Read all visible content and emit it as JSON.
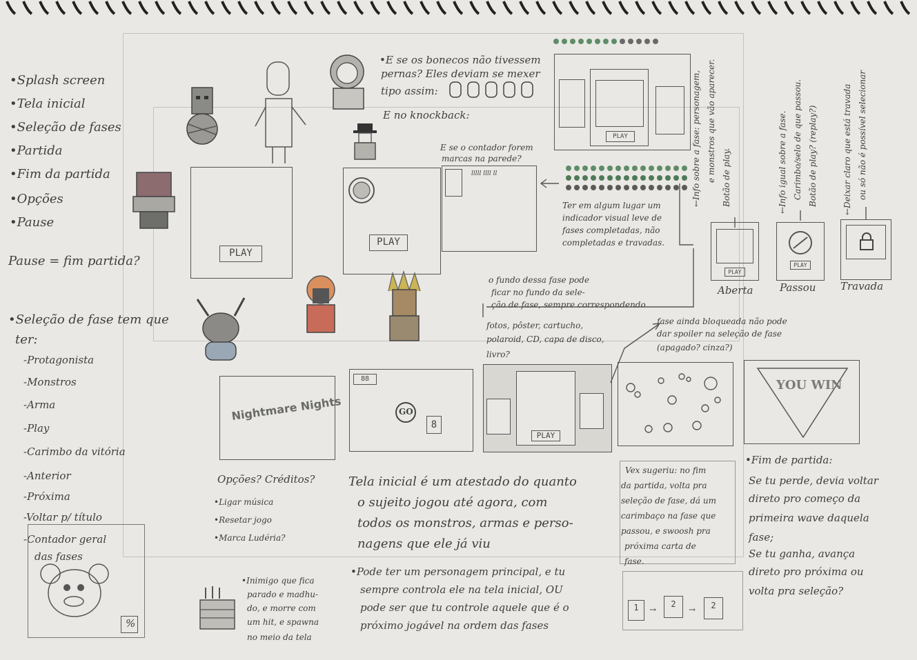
{
  "notes": {
    "screen_list": [
      "•Splash screen",
      "•Tela inicial",
      "•Seleção de fases",
      "•Partida",
      "•Fim da partida",
      "•Opções",
      "•Pause"
    ],
    "pause_note": "Pause = fim partida?",
    "selection_title": "•Seleção de fase tem que",
    "selection_title2": "ter:",
    "selection_items": [
      "-Protagonista",
      "-Monstros",
      "-Arma",
      "-Play",
      "-Carimbo da vitória",
      "-Anterior",
      "-Próxima",
      "-Voltar p/ título",
      "-Contador geral",
      "das fases"
    ],
    "percent": "%",
    "puppets_note": [
      "•E se os bonecos não tivessem",
      "pernas? Eles deviam se mexer",
      "tipo assim:"
    ],
    "knockback_note": "E no knockback:",
    "counter_wall_note": [
      "E se o contador forem",
      "marcas na parede?"
    ],
    "progress_note": [
      "Ter em algum lugar um",
      "indicador visual leve de",
      "fases completadas, não",
      "completadas e travadas."
    ],
    "background_note": [
      "o fundo dessa fase pode",
      "ficar no fundo da sele-",
      "ção de fase, sempre correspondendo",
      "fotos, pôster, cartucho,",
      "polaroid, CD, capa de disco,",
      "livro?"
    ],
    "locked_note": [
      "fase ainda bloqueada não pode",
      "dar spoiler na seleção de fase",
      "(apagado? cinza?)"
    ],
    "options_note": [
      "Opções? Créditos?",
      "•Ligar música",
      "•Resetar jogo",
      "•Marca Ludéria?"
    ],
    "title_screen_note": [
      "Tela inicial é um atestado do quanto",
      "o sujeito jogou até agora, com",
      "todos os monstros, armas e perso-",
      "nagens que ele já viu"
    ],
    "character_note": [
      "•Pode ter um personagem principal, e tu",
      "sempre controla ele na tela inicial, OU",
      "pode ser que tu controle aquele que é o",
      "próximo jogável na ordem das fases"
    ],
    "enemy_note": [
      "•Inimigo que fica",
      "parado e madhu-",
      "do, e morre com",
      "um hit, e spawna",
      "no meio da tela"
    ],
    "vex_note": [
      "Vex sugeriu: no fim",
      "da partida, volta pra",
      "seleção de fase, dá um",
      "carimbaço na fase que",
      "passou, e swoosh pra",
      "próxima carta de",
      "fase."
    ],
    "end_note": [
      "•Fim de partida:",
      "Se tu perde, devia voltar",
      "direto pro começo da",
      "primeira wave daquela",
      "fase;",
      "Se tu ganha, avança",
      "direto pro próxima ou",
      "volta pra seleção?"
    ],
    "vertical_notes": {
      "v1": "←Info sobre a fase: personagem,",
      "v1b": "e monstros que vão aparecer.",
      "v1c": "Botão de play.",
      "v2": "←Info igual sobre a fase.",
      "v2b": "Carimbo/selo de que passou.",
      "v2c": "Botão de play? (replay?)",
      "v3": "←Deixar claro que está travada",
      "v3b": "ou só não é possível selecionar"
    },
    "card_states": [
      "Aberta",
      "Passou",
      "Travada"
    ],
    "card_play": "PLAY",
    "play_big": "PLAY",
    "play_card": "PLAY",
    "splash_title": "Nightmare Nights",
    "you_win": "YOU WIN",
    "hud_timer": "88",
    "hud_go": "GO",
    "hud_number": "8",
    "wall_marks": "lllll llll ll",
    "mini_cards": [
      "1",
      "2",
      "2"
    ],
    "mini_cards_labels": [
      "PLAY",
      "PLAY",
      "PLAY"
    ]
  }
}
